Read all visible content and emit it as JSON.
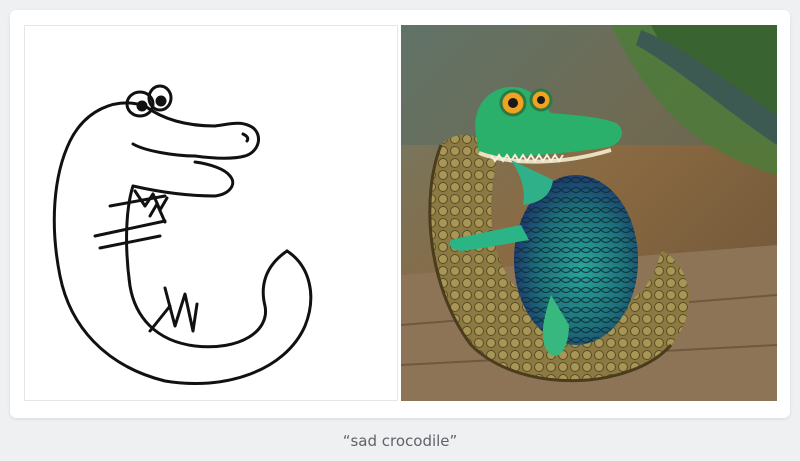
{
  "caption": "“sad crocodile”",
  "images": {
    "sketch": {
      "icon": "crocodile-sketch-image"
    },
    "render": {
      "icon": "crocodile-render-image"
    }
  },
  "colors": {
    "background": "#eef0f2",
    "card": "#ffffff",
    "caption": "#5f6368"
  }
}
